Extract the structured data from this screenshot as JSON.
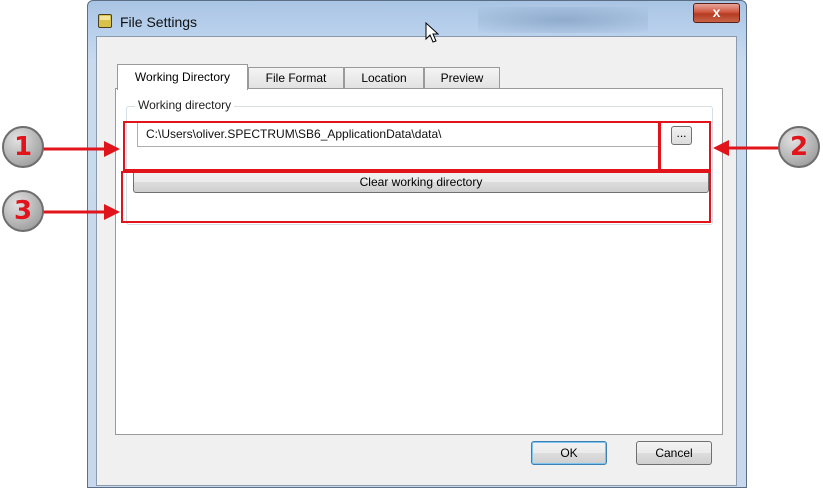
{
  "window": {
    "title": "File Settings",
    "close_label": "x",
    "icon": "app-icon"
  },
  "tabs": [
    {
      "label": "Working Directory",
      "active": true
    },
    {
      "label": "File Format",
      "active": false
    },
    {
      "label": "Location",
      "active": false
    },
    {
      "label": "Preview",
      "active": false
    }
  ],
  "working_directory": {
    "group_label": "Working directory",
    "path_value": "C:\\Users\\oliver.SPECTRUM\\SB6_ApplicationData\\data\\",
    "browse_label": "...",
    "clear_label": "Clear working directory"
  },
  "footer": {
    "ok_label": "OK",
    "cancel_label": "Cancel"
  },
  "annotations": {
    "callouts": [
      "1",
      "2",
      "3"
    ],
    "color": "#e0141a"
  }
}
